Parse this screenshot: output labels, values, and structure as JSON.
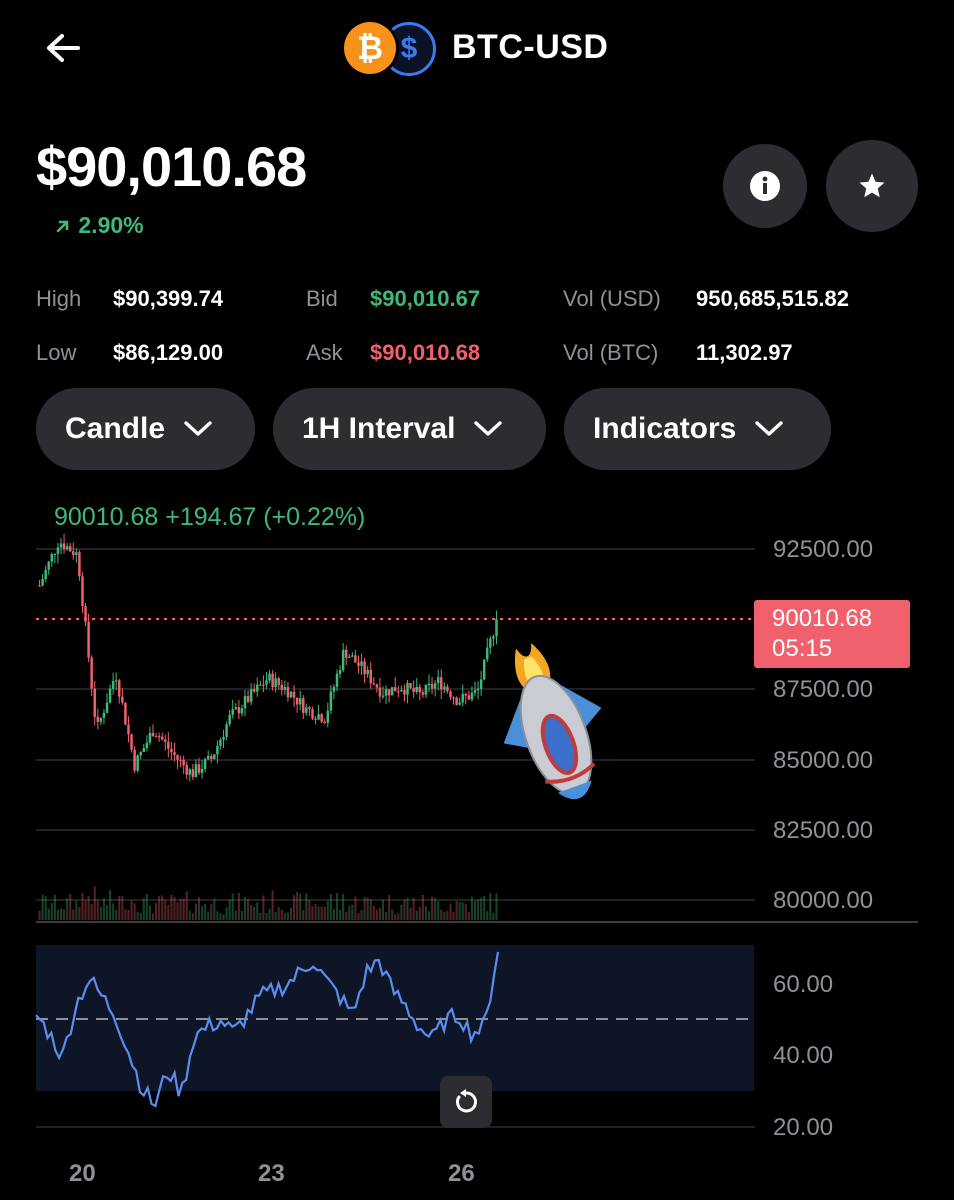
{
  "header": {
    "pair": "BTC-USD",
    "base_symbol": "₿",
    "quote_symbol": "$",
    "icons": {
      "back": "back-arrow-icon",
      "info": "info-icon",
      "favorite": "star-icon"
    }
  },
  "price": {
    "last": "$90,010.68",
    "change_pct": "2.90%"
  },
  "stats": {
    "high_label": "High",
    "high": "$90,399.74",
    "low_label": "Low",
    "low": "$86,129.00",
    "bid_label": "Bid",
    "bid": "$90,010.67",
    "ask_label": "Ask",
    "ask": "$90,010.68",
    "vol_usd_label": "Vol (USD)",
    "vol_usd": "950,685,515.82",
    "vol_btc_label": "Vol (BTC)",
    "vol_btc": "11,302.97"
  },
  "controls": {
    "chart_type": "Candle",
    "interval": "1H Interval",
    "indicators": "Indicators"
  },
  "chart": {
    "ohlc_readout": "90010.68  +194.67 (+0.22%)",
    "current_price": "90010.68",
    "countdown": "05:15",
    "price_ticks": [
      "92500.00",
      "87500.00",
      "85000.00",
      "82500.00",
      "80000.00"
    ],
    "rsi_ticks": [
      "60.00",
      "40.00",
      "20.00"
    ],
    "x_labels": [
      "20",
      "23",
      "26"
    ]
  },
  "colors": {
    "up": "#3fb97a",
    "down": "#f0616d",
    "rsi": "#5b8def",
    "bg": "#000000",
    "button": "#2b2d31"
  },
  "chart_data": {
    "type": "line",
    "series": [
      {
        "values": [
          91200,
          92800,
          92300,
          86000,
          88100,
          84800,
          86100,
          85200,
          84500,
          85000,
          86500,
          87200,
          87900,
          87500,
          86800,
          86500,
          88900,
          88200,
          87400,
          87600,
          87300,
          87800,
          87100,
          87400,
          90010.68
        ]
      }
    ],
    "ylim": [
      80000,
      93000
    ],
    "x_ticks": [
      "20",
      "23",
      "26"
    ]
  }
}
